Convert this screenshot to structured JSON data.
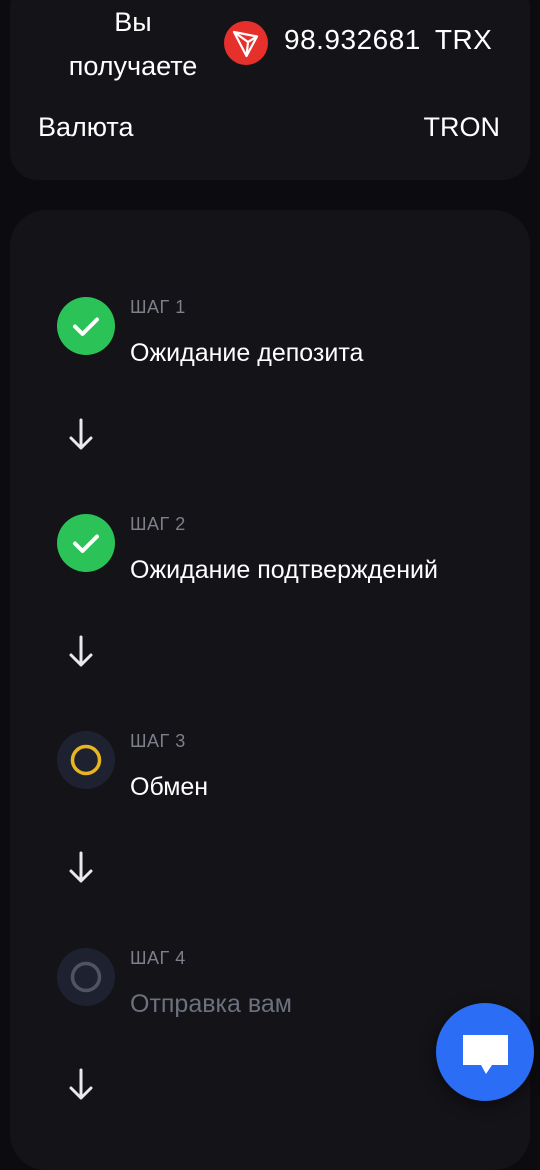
{
  "receive": {
    "label_line1": "Вы",
    "label_line2": "получаете",
    "amount": "98.932681",
    "currency_code": "TRX",
    "coin_icon": "tron-icon"
  },
  "currency_row": {
    "label": "Валюта",
    "value": "TRON"
  },
  "steps": [
    {
      "num": "ШАГ 1",
      "title": "Ожидание депозита",
      "status": "done"
    },
    {
      "num": "ШАГ 2",
      "title": "Ожидание подтверждений",
      "status": "done"
    },
    {
      "num": "ШАГ 3",
      "title": "Обмен",
      "status": "in-progress"
    },
    {
      "num": "ШАГ 4",
      "title": "Отправка вам",
      "status": "pending"
    }
  ],
  "chat": {
    "icon": "chat-icon"
  },
  "colors": {
    "background": "#0c0c10",
    "card": "#131318",
    "done": "#2bc357",
    "in_progress": "#e8b41f",
    "pending": "#4a4f5e",
    "chat_button": "#2b6df5",
    "tron": "#e5302b"
  }
}
